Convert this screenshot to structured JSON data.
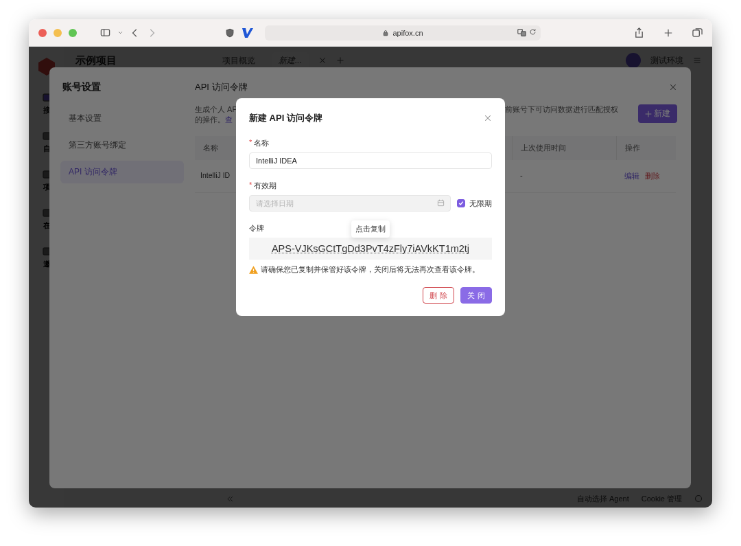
{
  "browser": {
    "url": "apifox.cn"
  },
  "app": {
    "project": "示例项目",
    "tabs": [
      {
        "label": "项目概览",
        "selected": false
      },
      {
        "label": "新建...",
        "selected": true
      }
    ],
    "environment": "测试环境",
    "rail": [
      "接",
      "自",
      "项",
      "在",
      "邀"
    ],
    "footer": {
      "agent": "自动选择 Agent",
      "cookie": "Cookie 管理"
    }
  },
  "settings": {
    "title": "账号设置",
    "nav": [
      {
        "label": "基本设置",
        "selected": false
      },
      {
        "label": "第三方账号绑定",
        "selected": false
      },
      {
        "label": "API 访问令牌",
        "selected": true
      }
    ],
    "heading": "API 访问令牌",
    "description": {
      "lines": [
        "生成个人 AP",
        "的操作。"
      ],
      "link": "查",
      "right": "前账号下可访问数据进行匹配授权"
    },
    "new_button": "新建",
    "table": {
      "columns": [
        "名称",
        "上次使用时间",
        "操作"
      ],
      "rows": [
        {
          "name": "IntelliJ ID",
          "last_used": "-",
          "actions": [
            {
              "label": "编辑",
              "kind": "edit"
            },
            {
              "label": "删除",
              "kind": "delete"
            }
          ]
        }
      ]
    }
  },
  "dialog": {
    "title": "新建 API 访问令牌",
    "name": {
      "label": "名称",
      "marker": "*",
      "value": "IntelliJ IDEA"
    },
    "expiry": {
      "label": "有效期",
      "marker": "*",
      "placeholder": "请选择日期",
      "disabled": true,
      "unlimited": {
        "label": "无限期",
        "checked": true
      }
    },
    "token": {
      "label": "令牌",
      "tooltip": "点击复制",
      "value": "APS-VJKsGCtTgDd3PvT4zFly7iAVkKT1m2tj"
    },
    "warning": "请确保您已复制并保管好该令牌，关闭后将无法再次查看该令牌。",
    "buttons": [
      {
        "label": "删 除",
        "kind": "danger"
      },
      {
        "label": "关 闭",
        "kind": "primary"
      }
    ]
  }
}
